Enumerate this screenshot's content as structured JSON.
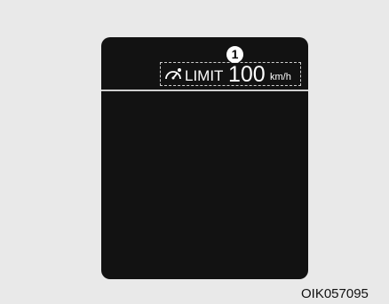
{
  "display": {
    "callout_number": "1",
    "limit_label": "LIMIT",
    "limit_value": "100",
    "limit_unit": "km/h",
    "icon": "speed-limit-icon"
  },
  "figure_code": "OIK057095"
}
